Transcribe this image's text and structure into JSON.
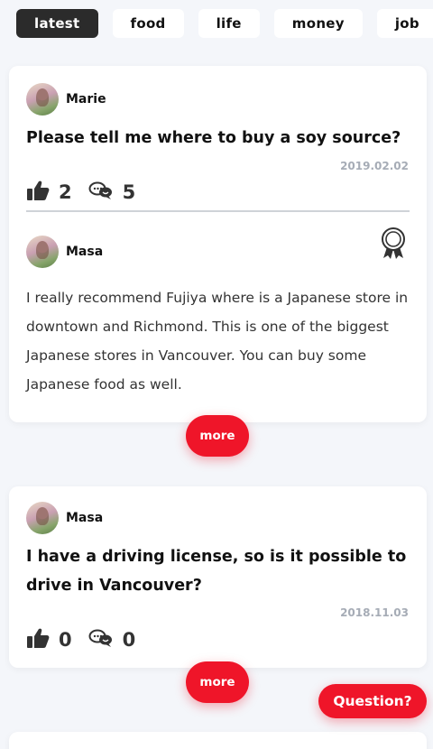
{
  "tabs": [
    {
      "label": "latest"
    },
    {
      "label": "food"
    },
    {
      "label": "life"
    },
    {
      "label": "money"
    },
    {
      "label": "job"
    }
  ],
  "posts": [
    {
      "author": "Marie",
      "question": "Please tell me where to buy a soy source?",
      "date": "2019.02.02",
      "likes": "2",
      "answers": "5",
      "top_answer": {
        "author": "Masa",
        "text": "I really recommend Fujiya where is a Japanese store in downtown and Richmond. This is one of the biggest Japanese stores in Vancouver. You can buy some Japanese food as well."
      },
      "more_label": "more"
    },
    {
      "author": "Masa",
      "question": "I have a driving license, so is it possible to drive in Vancouver?",
      "date": "2018.11.03",
      "likes": "0",
      "answers": "0",
      "more_label": "more"
    }
  ],
  "ask_button": "Question?",
  "icons": {
    "like": "thumbs-up-icon",
    "answers": "chat-bubbles-icon",
    "best_answer": "award-ribbon-icon"
  },
  "colors": {
    "accent": "#ef1529",
    "active_tab": "#2b2b2b",
    "date": "#a6acb6"
  }
}
